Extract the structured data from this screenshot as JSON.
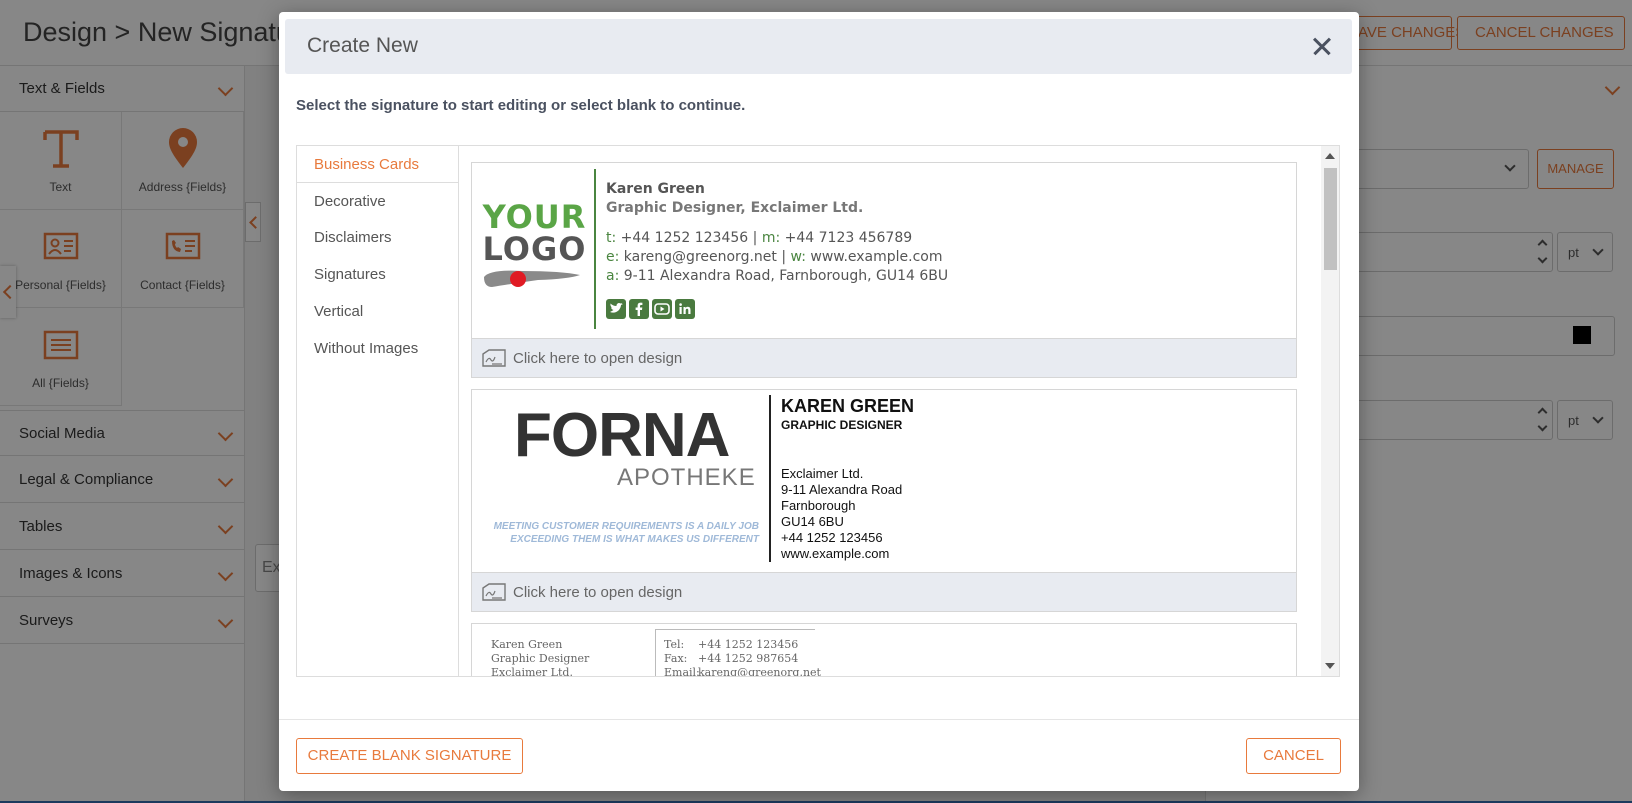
{
  "app": {
    "title": "Design >  New Signature",
    "save_changes_label": "SAVE CHANGES",
    "cancel_changes_label": "CANCEL CHANGES"
  },
  "sidebar": {
    "sections": [
      {
        "label": "Text & Fields"
      },
      {
        "label": "Social Media"
      },
      {
        "label": "Legal & Compliance"
      },
      {
        "label": "Tables"
      },
      {
        "label": "Images & Icons"
      },
      {
        "label": "Surveys"
      }
    ],
    "tiles": [
      {
        "label": "Text",
        "icon": "text-icon"
      },
      {
        "label": "Address {Fields}",
        "icon": "map-pin-icon"
      },
      {
        "label": "Personal {Fields}",
        "icon": "id-card-icon"
      },
      {
        "label": "Contact {Fields}",
        "icon": "contact-card-icon"
      },
      {
        "label": "All {Fields}",
        "icon": "list-box-icon"
      }
    ],
    "search_value": "Ex"
  },
  "right_panel": {
    "manage_label": "MANAGE",
    "unit_1": "pt",
    "unit_2": "pt",
    "color_swatch": "#000000"
  },
  "modal": {
    "title": "Create New",
    "instruction": "Select the signature to start editing or select blank to continue.",
    "categories": [
      {
        "label": "Business Cards",
        "active": true
      },
      {
        "label": "Decorative"
      },
      {
        "label": "Disclaimers"
      },
      {
        "label": "Signatures"
      },
      {
        "label": "Vertical"
      },
      {
        "label": "Without Images"
      }
    ],
    "open_design_label": "Click here to open design",
    "card1": {
      "logo_line1": "YOUR",
      "logo_line2": "LOGO",
      "name": "Karen Green",
      "role": "Graphic Designer, Exclaimer Ltd.",
      "t_label": "t:",
      "phone": "+44 1252 123456",
      "sep": "|",
      "m_label": "m:",
      "mobile": "+44 7123 456789",
      "e_label": "e:",
      "email": "kareng@greenorg.net",
      "sep2": "|",
      "w_label": "w:",
      "web": "www.example.com",
      "a_label": "a:",
      "address": "9-11 Alexandra Road, Farnborough, GU14 6BU",
      "brand_green": "#4a8540"
    },
    "card2": {
      "logo_main": "FORNA",
      "logo_sub": "APOTHEKE",
      "motto_line1": "MEETING CUSTOMER REQUIREMENTS IS A DAILY JOB",
      "motto_line2": "EXCEEDING THEM IS WHAT MAKES US DIFFERENT",
      "name": "KAREN GREEN",
      "role": "GRAPHIC DESIGNER",
      "company": "Exclaimer Ltd.",
      "street": "9-11 Alexandra Road",
      "town": "Farnborough",
      "postcode": "GU14 6BU",
      "phone": "+44 1252 123456",
      "web": "www.example.com"
    },
    "card3": {
      "name": "Karen Green",
      "role": "Graphic Designer",
      "company": "Exclaimer Ltd.",
      "tel_label": "Tel:",
      "tel": "+44 1252 123456",
      "fax_label": "Fax:",
      "fax": "+44 1252 987654",
      "email_label": "Email:",
      "email": "kareng@greenorg.net"
    },
    "create_blank_label": "CREATE BLANK SIGNATURE",
    "cancel_label": "CANCEL"
  },
  "accent_color": "#e87a3d"
}
